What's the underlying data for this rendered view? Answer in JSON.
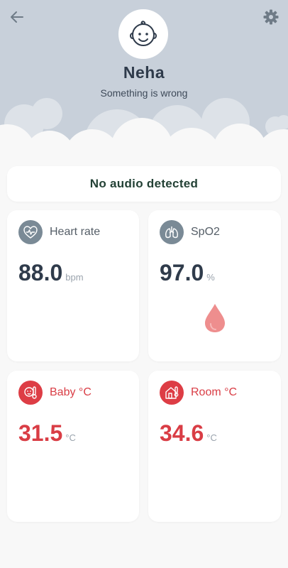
{
  "profile": {
    "name": "Neha",
    "status": "Something is wrong",
    "avatar_icon": "baby-face-icon"
  },
  "toolbar": {
    "back_icon": "arrow-left-icon",
    "settings_icon": "gear-icon"
  },
  "banner": {
    "text": "No audio detected"
  },
  "metrics": [
    {
      "label": "Heart rate",
      "value": "88.0",
      "unit": "bpm",
      "icon": "heart-rate-icon"
    },
    {
      "label": "SpO2",
      "value": "97.0",
      "unit": "%",
      "icon": "lungs-icon"
    },
    {
      "label": "Baby °C",
      "value": "31.5",
      "unit": "°C",
      "icon": "baby-thermometer-icon"
    },
    {
      "label": "Room °C",
      "value": "34.6",
      "unit": "°C",
      "icon": "room-thermometer-icon"
    }
  ],
  "colors": {
    "header_bg": "#c8d0da",
    "accent_red": "#dd3d45",
    "icon_gray": "#7a8a96",
    "text_dark": "#2f3b4b",
    "banner_text": "#234135"
  }
}
